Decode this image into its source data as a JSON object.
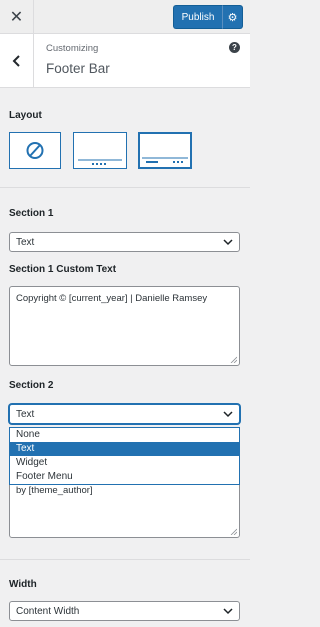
{
  "topbar": {
    "close_icon": "close-icon",
    "publish_label": "Publish",
    "settings_icon": "gear-icon"
  },
  "header": {
    "breadcrumb": "Customizing",
    "title": "Footer Bar",
    "help_icon": "help-icon",
    "back_icon": "chevron-left-icon"
  },
  "layout": {
    "label": "Layout",
    "options": [
      "none-layout-icon",
      "centered-footer-layout-icon",
      "split-footer-layout-icon"
    ],
    "selected_index": 2
  },
  "section1": {
    "label": "Section 1",
    "select_value": "Text"
  },
  "section1_custom": {
    "label": "Section 1 Custom Text",
    "value": "Copyright © [current_year] | Danielle Ramsey"
  },
  "section2": {
    "label": "Section 2",
    "select_value": "Text",
    "options": [
      "None",
      "Text",
      "Widget",
      "Footer Menu"
    ],
    "highlighted_index": 1,
    "custom_text_partial": "by [theme_author]"
  },
  "width": {
    "label": "Width",
    "select_value": "Content Width"
  },
  "colors": {
    "accent": "#2271b1",
    "background": "#f0f0f1"
  }
}
